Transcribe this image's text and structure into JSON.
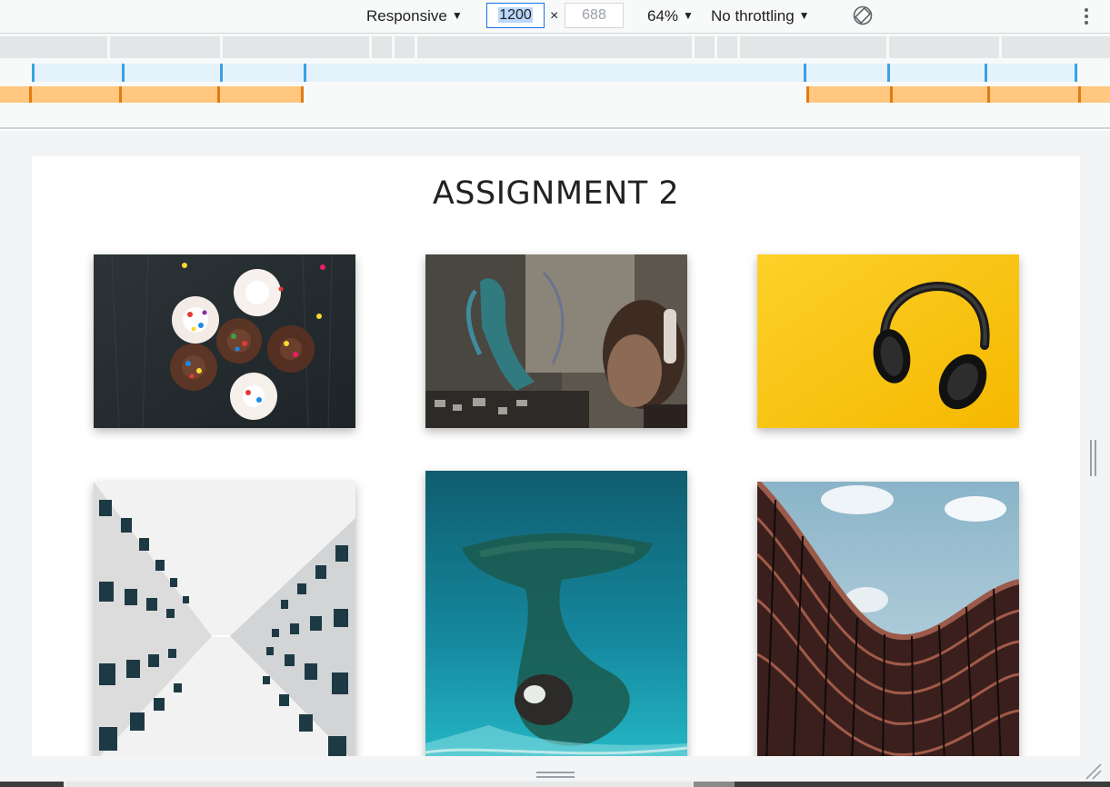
{
  "toolbar": {
    "device": "Responsive",
    "width_value": "1200",
    "height_placeholder": "688",
    "times": "×",
    "zoom": "64%",
    "throttling": "No throttling",
    "rotate_icon": "rotate-icon",
    "more_icon": "kebab-menu-icon"
  },
  "colors": {
    "toolbar_bg": "#f8f9f9",
    "focus_blue": "#1a73e8",
    "media_gray": "#e4e5e7",
    "media_blue": "#e4f3fb",
    "media_blue_tick": "#3aa2e4",
    "media_orange": "#ffc77f",
    "media_orange_tick": "#e07c13"
  },
  "page": {
    "title": "ASSIGNMENT 2",
    "photos": [
      "cupcakes-photo",
      "graffiti-headphones-photo",
      "yellow-headphones-photo",
      "building-perspective-photo",
      "ocean-reef-photo",
      "curved-building-photo"
    ]
  }
}
